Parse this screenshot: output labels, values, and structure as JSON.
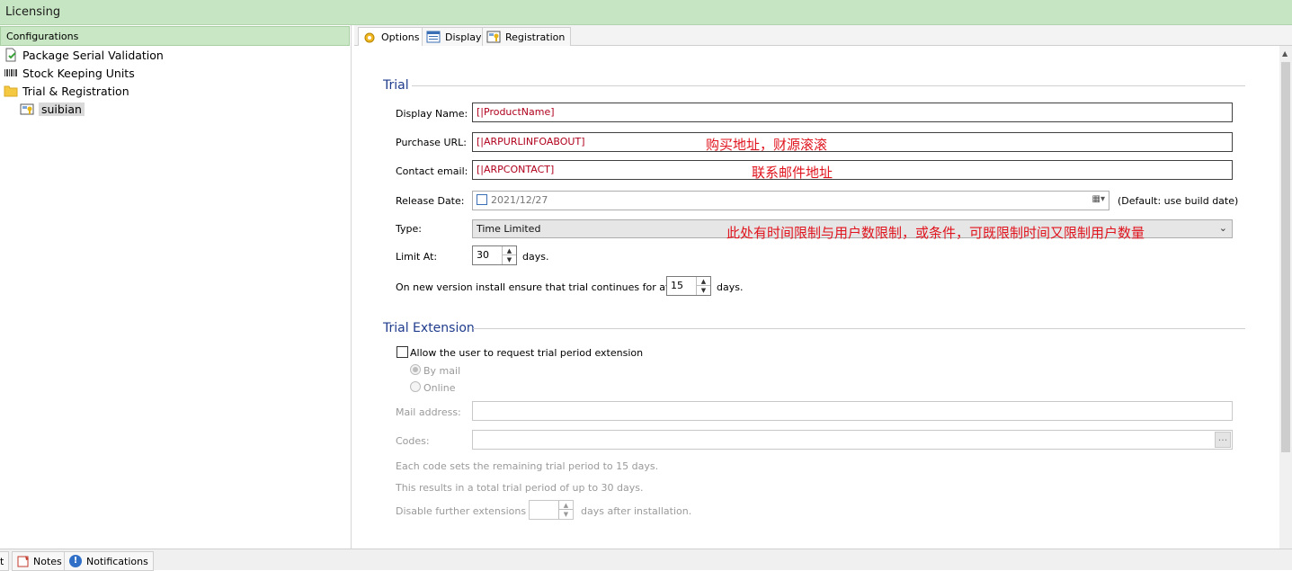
{
  "window": {
    "title": "Licensing"
  },
  "left_panel": {
    "header": "Configurations",
    "items": [
      {
        "label": "Package Serial Validation",
        "icon": "document-check-icon"
      },
      {
        "label": "Stock Keeping Units",
        "icon": "barcode-icon"
      },
      {
        "label": "Trial & Registration",
        "icon": "folder-icon"
      },
      {
        "label": "suibian",
        "icon": "license-key-icon",
        "selected": true
      }
    ]
  },
  "tabs": [
    {
      "label": "Options",
      "icon": "gear-icon",
      "active": true
    },
    {
      "label": "Display",
      "icon": "window-icon"
    },
    {
      "label": "Registration",
      "icon": "license-key-icon"
    }
  ],
  "trial": {
    "section_title": "Trial",
    "display_name_label": "Display Name:",
    "display_name_value": "[|ProductName]",
    "purchase_url_label": "Purchase URL:",
    "purchase_url_value": "[|ARPURLINFOABOUT]",
    "purchase_url_annotation": "购买地址，财源滚滚",
    "contact_email_label": "Contact email:",
    "contact_email_value": "[|ARPCONTACT]",
    "contact_email_annotation": "联系邮件地址",
    "release_date_label": "Release Date:",
    "release_date_value": "2021/12/27",
    "release_date_hint": "(Default: use build date)",
    "type_label": "Type:",
    "type_value": "Time Limited",
    "type_annotation": "此处有时间限制与用户数限制，或条件，可既限制时间又限制用户数量",
    "limit_label": "Limit At:",
    "limit_value": "30",
    "limit_unit": "days.",
    "new_version_label": "On new version install ensure that trial continues for at least",
    "new_version_value": "15",
    "new_version_unit": "days."
  },
  "extension": {
    "section_title": "Trial Extension",
    "allow_label": "Allow the user to request trial period extension",
    "by_mail_label": "By mail",
    "online_label": "Online",
    "mail_address_label": "Mail address:",
    "codes_label": "Codes:",
    "codes_button": "...",
    "info_line1": "Each code sets the remaining trial period to 15 days.",
    "info_line2": "This results in a total trial period of up to 30 days.",
    "disable_label": "Disable further extensions at",
    "disable_unit": "days after installation."
  },
  "bottom_tabs": [
    {
      "label": "t",
      "icon": ""
    },
    {
      "label": "Notes",
      "icon": "notes-icon"
    },
    {
      "label": "Notifications",
      "icon": "info-icon"
    }
  ],
  "colors": {
    "title_bar": "#c6e5c2",
    "section_title": "#1f3c8c",
    "field_text": "#b0001d",
    "annotation": "#e0141e"
  }
}
